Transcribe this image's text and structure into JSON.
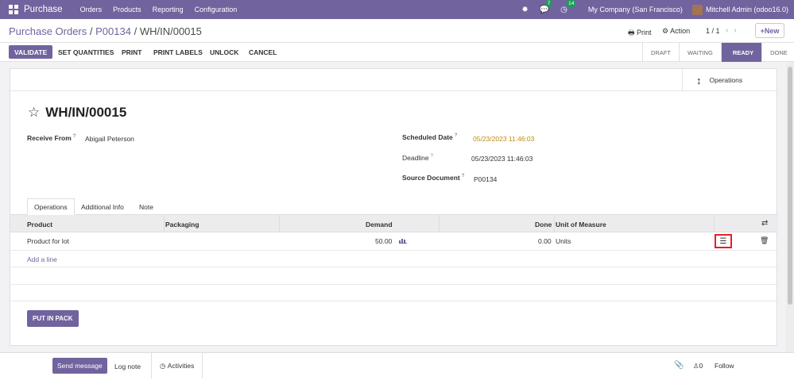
{
  "topbar": {
    "app_name": "Purchase",
    "menu": [
      "Orders",
      "Products",
      "Reporting",
      "Configuration"
    ],
    "messages_badge": "7",
    "activities_badge": "14",
    "company": "My Company (San Francisco)",
    "user": "Mitchell Admin (odoo16.0)"
  },
  "breadcrumb": {
    "root": "Purchase Orders",
    "middle": "P00134",
    "current": "WH/IN/00015",
    "sep": "/"
  },
  "control": {
    "print": "Print",
    "action": "Action",
    "pager": "1 / 1",
    "new": "New"
  },
  "actions": {
    "validate": "VALIDATE",
    "set_quantities": "SET QUANTITIES",
    "print": "PRINT",
    "print_labels": "PRINT LABELS",
    "unlock": "UNLOCK",
    "cancel": "CANCEL"
  },
  "status_stages": [
    "DRAFT",
    "WAITING",
    "READY",
    "DONE"
  ],
  "current_stage": "READY",
  "smart_button": {
    "label": "Operations"
  },
  "record": {
    "name": "WH/IN/00015",
    "receive_from_label": "Receive From",
    "receive_from": "Abigail Peterson",
    "scheduled_date_label": "Scheduled Date",
    "scheduled_date": "05/23/2023 11:46:03",
    "deadline_label": "Deadline",
    "deadline": "05/23/2023 11:46:03",
    "source_document_label": "Source Document",
    "source_document": "P00134",
    "help_mark": "?"
  },
  "tabs": [
    "Operations",
    "Additional Info",
    "Note"
  ],
  "table": {
    "headers": {
      "product": "Product",
      "packaging": "Packaging",
      "demand": "Demand",
      "done": "Done",
      "uom": "Unit of Measure"
    },
    "rows": [
      {
        "product": "Product for lot",
        "packaging": "",
        "demand": "50.00",
        "done": "0.00",
        "uom": "Units"
      }
    ],
    "add_line": "Add a line"
  },
  "put_in_pack": "PUT IN PACK",
  "chatter": {
    "send_message": "Send message",
    "log_note": "Log note",
    "activities": "Activities",
    "followers_count": "0",
    "follow": "Follow"
  },
  "colors": {
    "brand": "#71639e",
    "warning_date": "#c08a10",
    "highlight_box": "#e0202a"
  }
}
